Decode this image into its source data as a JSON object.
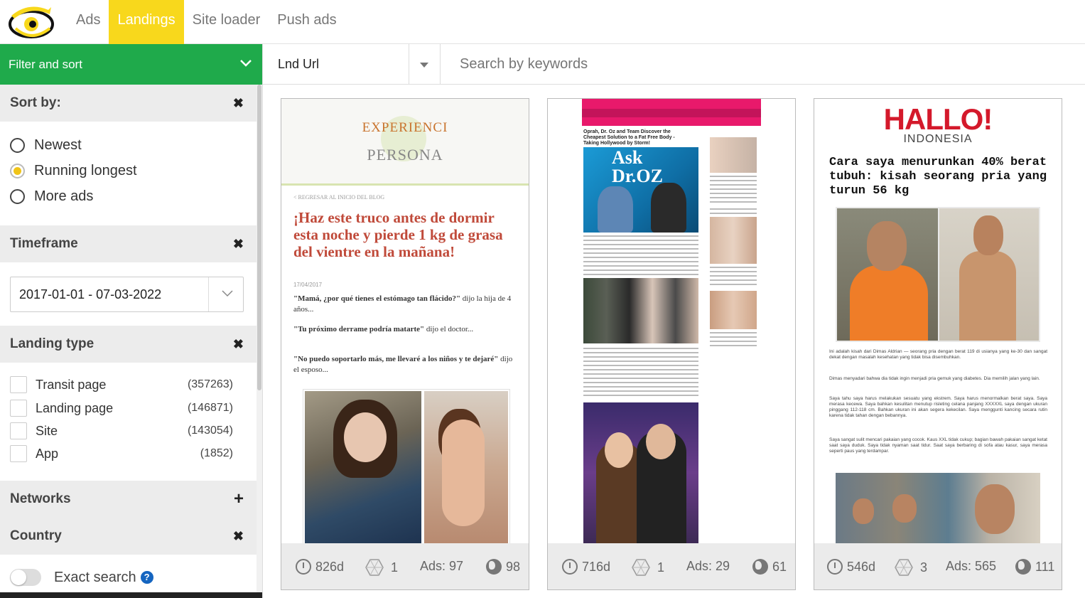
{
  "nav": {
    "tabs": [
      {
        "label": "Ads",
        "active": false
      },
      {
        "label": "Landings",
        "active": true
      },
      {
        "label": "Site loader",
        "active": false
      },
      {
        "label": "Push ads",
        "active": false
      }
    ],
    "active_color": "#f8d81c"
  },
  "sidebar": {
    "filter_label": "Filter and sort",
    "accent_color": "#1faa4b",
    "sort": {
      "title": "Sort by:",
      "options": [
        {
          "label": "Newest",
          "selected": false
        },
        {
          "label": "Running longest",
          "selected": true
        },
        {
          "label": "More ads",
          "selected": false
        }
      ]
    },
    "timeframe": {
      "title": "Timeframe",
      "value": "2017-01-01 - 07-03-2022"
    },
    "landing_type": {
      "title": "Landing type",
      "options": [
        {
          "label": "Transit page",
          "count": "(357263)"
        },
        {
          "label": "Landing page",
          "count": "(146871)"
        },
        {
          "label": "Site",
          "count": "(143054)"
        },
        {
          "label": "App",
          "count": "(1852)"
        }
      ]
    },
    "networks": {
      "title": "Networks"
    },
    "country": {
      "title": "Country"
    },
    "exact_search": {
      "label": "Exact search",
      "help": "?"
    }
  },
  "toolbar": {
    "field_select": "Lnd Url",
    "search_placeholder": "Search by keywords"
  },
  "cards": [
    {
      "days": "826d",
      "networks": "1",
      "ads": "Ads: 97",
      "geos": "98",
      "preview": {
        "logo_line1": "EXPERIENCI",
        "logo_line2": "PERSONA",
        "back_link": "< REGRESAR AL INICIO DEL BLOG",
        "title": "¡Haz este truco antes de dormir esta noche y pierde 1 kg de grasa del vientre en la mañana!",
        "date": "17/04/2017",
        "p1_bold": "\"Mamá, ¿por qué tienes el estómago tan flácido?\"",
        "p1_rest": " dijo la hija de 4 años...",
        "p2_bold": "\"Tu próximo derrame podría matarte\"",
        "p2_rest": " dijo el doctor...",
        "p3_bold": "\"No puedo soportarlo más, me llevaré a los niños y te dejaré\"",
        "p3_rest": " dijo el esposo..."
      }
    },
    {
      "days": "716d",
      "networks": "1",
      "ads": "Ads: 29",
      "geos": "61",
      "preview": {
        "headline": "Oprah, Dr. Oz and Team Discover the Cheapest Solution to a Fat Free Body - Taking Hollywood by Storm!",
        "show_logo": "Ask Dr.OZ"
      }
    },
    {
      "days": "546d",
      "networks": "3",
      "ads": "Ads: 565",
      "geos": "111",
      "preview": {
        "logo": "HALLO!",
        "logo_sub": "INDONESIA",
        "title": "Cara saya menurunkan 40% berat tubuh: kisah seorang pria yang turun 56 kg",
        "p1": "Ini adalah kisah dari Dimas Aldrian — seorang pria dengan berat 119 di usianya yang ke-30 dan sangat dekat dengan masalah kesehatan yang tidak bisa disembuhkan.",
        "p2": "Dimas menyadari bahwa dia tidak ingin menjadi pria gemuk yang diabetes. Dia memilih jalan yang lain.",
        "p3": "Saya tahu saya harus melakukan sesuatu yang ekstrem. Saya harus menormalkan berat saya. Saya merasa kecewa. Saya bahkan kesulitan menutup risleting celana panjang XXXXXL saya dengan ukuran pinggang 112-118 cm. Bahkan ukuran ini akan segera kekecilan. Saya menggunti kancing secara rutin karena tidak tahan dengan bebannya.",
        "p4": "Saya sangat sulit mencari pakaian yang cocok. Kaus XXL tidak cukup; bagian bawah pakaian sangat ketat saat saya duduk. Saya tidak nyaman saat tidur. Saat saya berbaring di sofa atau kasur, saya merasa seperti paus yang terdampar."
      }
    }
  ]
}
